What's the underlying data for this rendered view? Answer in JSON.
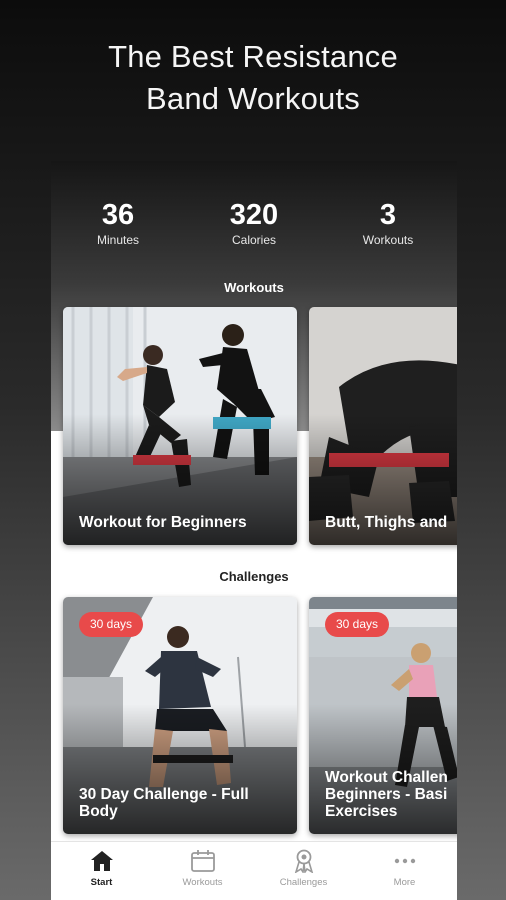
{
  "headline": {
    "line1": "The Best Resistance",
    "line2": "Band Workouts"
  },
  "stats": [
    {
      "value": "36",
      "label": "Minutes"
    },
    {
      "value": "320",
      "label": "Calories"
    },
    {
      "value": "3",
      "label": "Workouts"
    }
  ],
  "sections": {
    "workouts": "Workouts",
    "challenges": "Challenges"
  },
  "workouts": [
    {
      "title": "Workout for Beginners"
    },
    {
      "title": "Butt, Thighs and"
    }
  ],
  "challenges": [
    {
      "badge": "30 days",
      "title": "30 Day Challenge - Full\nBody"
    },
    {
      "badge": "30 days",
      "title": "Workout Challen\nBeginners - Basi\nExercises"
    }
  ],
  "tabs": [
    {
      "label": "Start",
      "icon": "home-icon",
      "active": true
    },
    {
      "label": "Workouts",
      "icon": "calendar-icon",
      "active": false
    },
    {
      "label": "Challenges",
      "icon": "award-icon",
      "active": false
    },
    {
      "label": "More",
      "icon": "more-dots-icon",
      "active": false
    }
  ],
  "colors": {
    "accent": "#e84a4a",
    "band": "#e23b45",
    "active_tab": "#222222",
    "inactive_tab": "#9a9a9a"
  }
}
